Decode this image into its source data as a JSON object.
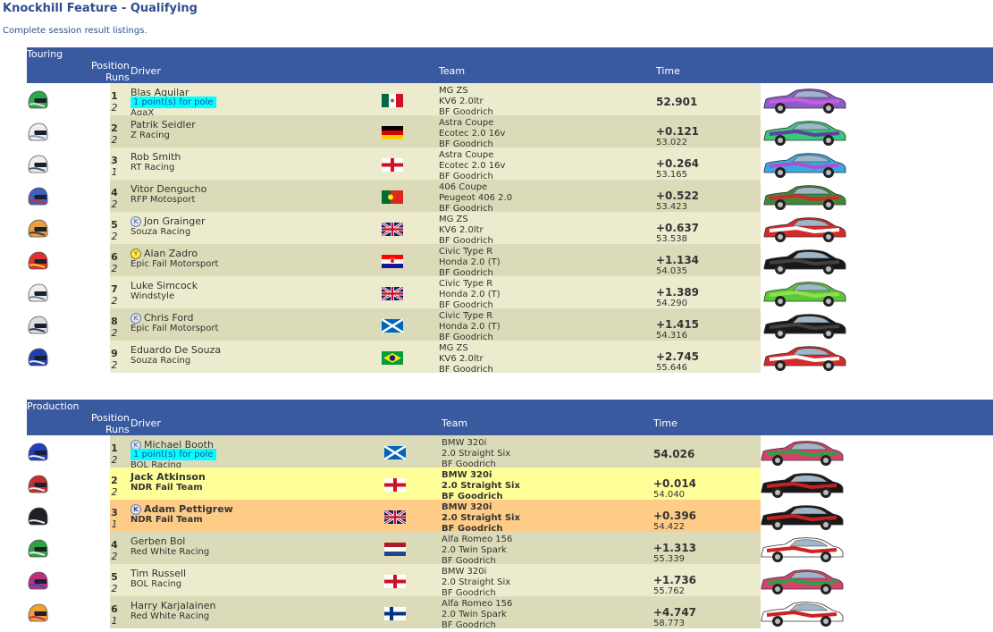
{
  "page": {
    "title": "Knockhill Feature - Qualifying",
    "subtitle": "Complete session result listings."
  },
  "headers": {
    "position": "Position",
    "runs": "Runs",
    "driver": "Driver",
    "team": "Team",
    "time": "Time"
  },
  "colors": {
    "header_bg": "#3a5aa0",
    "row_a": "#ecebcd",
    "row_b": "#dcdbb9",
    "highlight_yellow": "#ffff99",
    "highlight_orange": "#ffcc88",
    "pole_bg": "#00ffff"
  },
  "sections": [
    {
      "name": "Touring",
      "rows": [
        {
          "pos": "1",
          "runs": "2",
          "driver": "Blas Aguilar",
          "pole": "1 point(s) for pole",
          "tag": "AgaX",
          "badge": "",
          "flag": "mexico",
          "team": [
            "MG ZS",
            "KV6 2.0ltr",
            "BF Goodrich"
          ],
          "gap": "52.901",
          "lap": "",
          "helmet": [
            "#2aa84a",
            "#dddddd"
          ],
          "car": [
            "#8e5cc8",
            "#c85ce0"
          ],
          "bg": "a"
        },
        {
          "pos": "2",
          "runs": "2",
          "driver": "Patrik Seidler",
          "pole": "",
          "tag": "Z Racing",
          "badge": "",
          "flag": "germany",
          "team": [
            "Astra Coupe",
            "Ecotec 2.0 16v",
            "BF Goodrich"
          ],
          "gap": "+0.121",
          "lap": "53.022",
          "helmet": [
            "#eeeeee",
            "#8aa0b8"
          ],
          "car": [
            "#38c878",
            "#6040a0"
          ],
          "bg": "b"
        },
        {
          "pos": "3",
          "runs": "1",
          "driver": "Rob Smith",
          "pole": "",
          "tag": "RT Racing",
          "badge": "",
          "flag": "england",
          "team": [
            "Astra Coupe",
            "Ecotec 2.0 16v",
            "BF Goodrich"
          ],
          "gap": "+0.264",
          "lap": "53.165",
          "helmet": [
            "#eeeeee",
            "#506070"
          ],
          "car": [
            "#38a8e0",
            "#b050d0"
          ],
          "bg": "a"
        },
        {
          "pos": "4",
          "runs": "2",
          "driver": "Vitor Dengucho",
          "pole": "",
          "tag": "RFP Motosport",
          "badge": "",
          "flag": "portugal",
          "team": [
            "406 Coupe",
            "Peugeot 406 2.0",
            "BF Goodrich"
          ],
          "gap": "+0.522",
          "lap": "53.423",
          "helmet": [
            "#4060c0",
            "#d03030"
          ],
          "car": [
            "#408838",
            "#c83030"
          ],
          "bg": "b"
        },
        {
          "pos": "5",
          "runs": "2",
          "driver": "Jon Grainger",
          "pole": "",
          "tag": "Souza Racing",
          "badge": "K",
          "flag": "uk",
          "team": [
            "MG ZS",
            "KV6 2.0ltr",
            "BF Goodrich"
          ],
          "gap": "+0.637",
          "lap": "53.538",
          "helmet": [
            "#e8a040",
            "#404040"
          ],
          "car": [
            "#d82828",
            "#ffffff"
          ],
          "bg": "a"
        },
        {
          "pos": "6",
          "runs": "2",
          "driver": "Alan Zadro",
          "pole": "",
          "tag": "Epic Fail Motorsport",
          "badge": "Y",
          "flag": "croatia",
          "team": [
            "Civic Type R",
            "Honda 2.0 (T)",
            "BF Goodrich"
          ],
          "gap": "+1.134",
          "lap": "54.035",
          "helmet": [
            "#e03030",
            "#f0d020"
          ],
          "car": [
            "#181818",
            "#404040"
          ],
          "bg": "b"
        },
        {
          "pos": "7",
          "runs": "2",
          "driver": "Luke Simcock",
          "pole": "",
          "tag": "Windstyle",
          "badge": "",
          "flag": "uk",
          "team": [
            "Civic Type R",
            "Honda 2.0 (T)",
            "BF Goodrich"
          ],
          "gap": "+1.389",
          "lap": "54.290",
          "helmet": [
            "#eeeeee",
            "#6a8aa0"
          ],
          "car": [
            "#58c838",
            "#90e050"
          ],
          "bg": "a"
        },
        {
          "pos": "8",
          "runs": "2",
          "driver": "Chris Ford",
          "pole": "",
          "tag": "Epic Fail Motorsport",
          "badge": "K",
          "flag": "scotland",
          "team": [
            "Civic Type R",
            "Honda 2.0 (T)",
            "BF Goodrich"
          ],
          "gap": "+1.415",
          "lap": "54.316",
          "helmet": [
            "#dddddd",
            "#304060"
          ],
          "car": [
            "#181818",
            "#404040"
          ],
          "bg": "b"
        },
        {
          "pos": "9",
          "runs": "2",
          "driver": "Eduardo De Souza",
          "pole": "",
          "tag": "Souza Racing",
          "badge": "",
          "flag": "brazil",
          "team": [
            "MG ZS",
            "KV6 2.0ltr",
            "BF Goodrich"
          ],
          "gap": "+2.745",
          "lap": "55.646",
          "helmet": [
            "#2040b0",
            "#eeeeee"
          ],
          "car": [
            "#d82828",
            "#ffffff"
          ],
          "bg": "a"
        }
      ]
    },
    {
      "name": "Production",
      "rows": [
        {
          "pos": "1",
          "runs": "2",
          "driver": "Michael Booth",
          "pole": "1 point(s) for pole",
          "tag": "BOL Racing",
          "badge": "K",
          "flag": "scotland",
          "team": [
            "BMW 320i",
            "2.0 Straight Six",
            "BF Goodrich"
          ],
          "gap": "54.026",
          "lap": "",
          "helmet": [
            "#2040c0",
            "#eeeeee"
          ],
          "car": [
            "#d84070",
            "#30a040"
          ],
          "bg": "b"
        },
        {
          "pos": "2",
          "runs": "2",
          "driver": "Jack Atkinson",
          "pole": "",
          "tag": "NDR Fail Team",
          "badge": "",
          "flag": "england",
          "team": [
            "BMW 320i",
            "2.0 Straight Six",
            "BF Goodrich"
          ],
          "gap": "+0.014",
          "lap": "54.040",
          "helmet": [
            "#c03030",
            "#eeeeee"
          ],
          "car": [
            "#181818",
            "#c82020"
          ],
          "bg": "yellow"
        },
        {
          "pos": "3",
          "runs": "1",
          "driver": "Adam Pettigrew",
          "pole": "",
          "tag": "NDR Fail Team",
          "badge": "K",
          "flag": "uk",
          "team": [
            "BMW 320i",
            "2.0 Straight Six",
            "BF Goodrich"
          ],
          "gap": "+0.396",
          "lap": "54.422",
          "helmet": [
            "#202020",
            "#eeeeee"
          ],
          "car": [
            "#181818",
            "#c82020"
          ],
          "bg": "orange"
        },
        {
          "pos": "4",
          "runs": "2",
          "driver": "Gerben Bol",
          "pole": "",
          "tag": "Red White Racing",
          "badge": "",
          "flag": "netherlands",
          "team": [
            "Alfa Romeo 156",
            "2.0 Twin Spark",
            "BF Goodrich"
          ],
          "gap": "+1.313",
          "lap": "55.339",
          "helmet": [
            "#30a040",
            "#eeeeee"
          ],
          "car": [
            "#ffffff",
            "#d02020"
          ],
          "bg": "b"
        },
        {
          "pos": "5",
          "runs": "2",
          "driver": "Tim Russell",
          "pole": "",
          "tag": "BOL Racing",
          "badge": "",
          "flag": "england",
          "team": [
            "BMW 320i",
            "2.0 Straight Six",
            "BF Goodrich"
          ],
          "gap": "+1.736",
          "lap": "55.762",
          "helmet": [
            "#c03080",
            "#3050c0"
          ],
          "car": [
            "#d84070",
            "#30a040"
          ],
          "bg": "a"
        },
        {
          "pos": "6",
          "runs": "1",
          "driver": "Harry Karjalainen",
          "pole": "",
          "tag": "Red White Racing",
          "badge": "",
          "flag": "finland",
          "team": [
            "Alfa Romeo 156",
            "2.0 Twin Spark",
            "BF Goodrich"
          ],
          "gap": "+4.747",
          "lap": "58.773",
          "helmet": [
            "#f0a030",
            "#c03060"
          ],
          "car": [
            "#ffffff",
            "#d02020"
          ],
          "bg": "b"
        }
      ]
    }
  ]
}
